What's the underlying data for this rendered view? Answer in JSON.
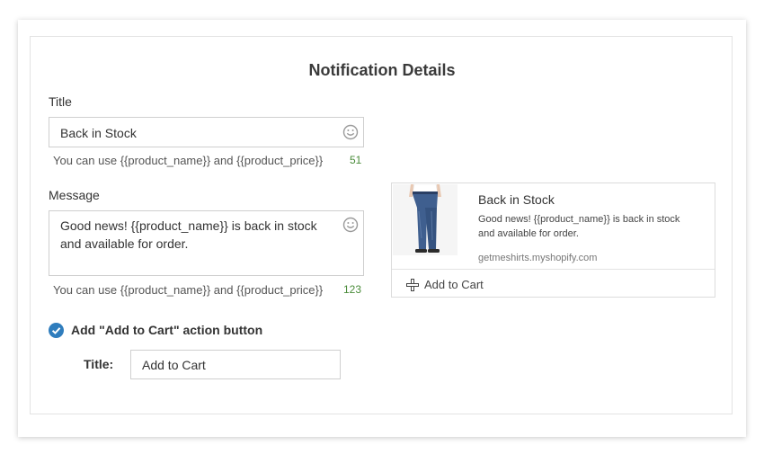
{
  "heading": "Notification Details",
  "title_field": {
    "label": "Title",
    "value": "Back in Stock",
    "hint": "You can use {{product_name}} and {{product_price}}",
    "count": "51",
    "icon": "smiley-icon"
  },
  "message_field": {
    "label": "Message",
    "value_line1": "Good news! {{product_name}} is back in stock",
    "value_line2": "and available for order.",
    "hint": "You can use {{product_name}} and {{product_price}}",
    "count": "123",
    "icon": "smiley-icon"
  },
  "action": {
    "checkbox_label": "Add \"Add to Cart\" action button",
    "checked": true,
    "title_label": "Title:",
    "title_value": "Add to Cart"
  },
  "preview": {
    "title": "Back in Stock",
    "message_line1": "Good news! {{product_name}} is back in stock",
    "message_line2": "and available for order.",
    "domain": "getmeshirts.myshopify.com",
    "button_label": "Add to Cart",
    "button_icon": "plus-icon",
    "image": "product-jeans-image"
  },
  "colors": {
    "accent": "#2f7dbd",
    "count_green": "#4a8c3a"
  }
}
